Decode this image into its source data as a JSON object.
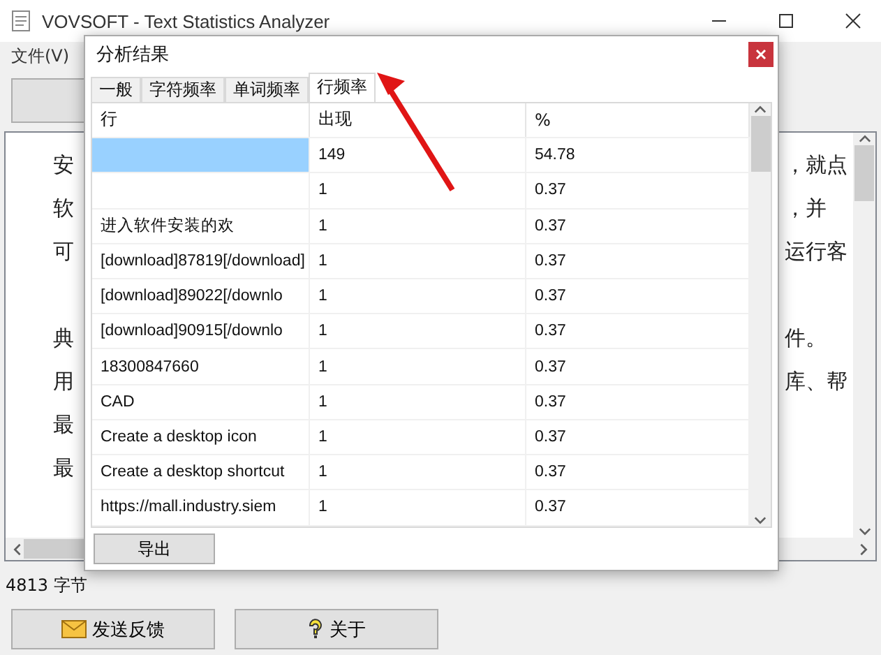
{
  "window": {
    "title": "VOVSOFT - Text Statistics Analyzer"
  },
  "menu": [
    "文件(V)"
  ],
  "editor": {
    "paragraphs": [
      [
        {
          "left": "安",
          "right": "，就点"
        },
        {
          "left": "软",
          "right": "，并"
        },
        {
          "left": "可",
          "right": "运行客"
        }
      ],
      [
        {
          "left": "典",
          "right": "件。"
        },
        {
          "left": "用",
          "right": "库、帮"
        },
        {
          "left": "最"
        },
        {
          "left": "最"
        }
      ]
    ]
  },
  "status": "4813 字节",
  "buttons": [
    {
      "label": "发送反馈",
      "kind": "mail"
    },
    {
      "label": "关于",
      "kind": "help"
    }
  ],
  "dialog": {
    "title": "分析结果",
    "tabs": [
      {
        "label": "一般",
        "selected": false
      },
      {
        "label": "字符频率",
        "selected": false
      },
      {
        "label": "单词频率",
        "selected": false
      },
      {
        "label": "行频率",
        "selected": true
      }
    ],
    "columns": [
      "行",
      "出现",
      "%"
    ],
    "rows": [
      {
        "line": "",
        "count": "149",
        "percent": "54.78",
        "selected": true
      },
      {
        "line": "",
        "count": "1",
        "percent": "0.37",
        "selected": false
      },
      {
        "line": "进入软件安装的欢",
        "count": "1",
        "percent": "0.37",
        "selected": false
      },
      {
        "line": "[download]87819[/download]",
        "count": "1",
        "percent": "0.37",
        "selected": false
      },
      {
        "line": "[download]89022[/downlo",
        "count": "1",
        "percent": "0.37",
        "selected": false
      },
      {
        "line": "[download]90915[/downlo",
        "count": "1",
        "percent": "0.37",
        "selected": false
      },
      {
        "line": "18300847660",
        "count": "1",
        "percent": "0.37",
        "selected": false
      },
      {
        "line": "CAD",
        "count": "1",
        "percent": "0.37",
        "selected": false
      },
      {
        "line": "Create a desktop icon",
        "count": "1",
        "percent": "0.37",
        "selected": false
      },
      {
        "line": "Create a desktop shortcut",
        "count": "1",
        "percent": "0.37",
        "selected": false
      },
      {
        "line": "https://mall.industry.siem",
        "count": "1",
        "percent": "0.37",
        "selected": false
      }
    ],
    "export": "导出"
  }
}
